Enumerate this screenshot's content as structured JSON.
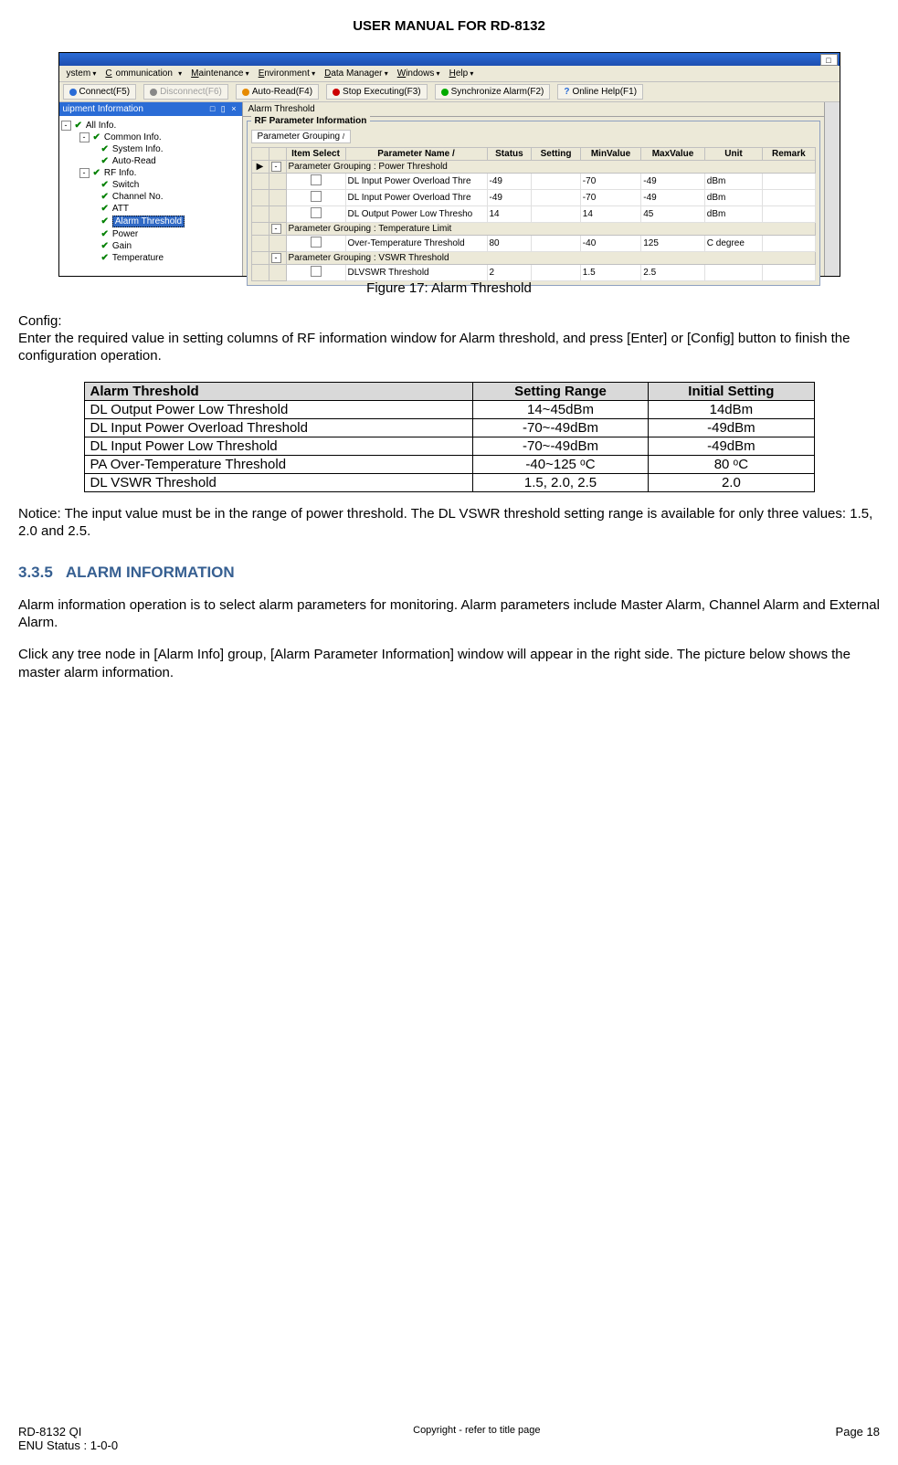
{
  "doc": {
    "title": "USER MANUAL FOR RD-8132"
  },
  "screenshot": {
    "menubar": [
      "ystem",
      "Communication",
      "Maintenance",
      "Environment",
      "Data Manager",
      "Windows",
      "Help"
    ],
    "toolbar": [
      {
        "label": "Connect(F5)",
        "disabled": false
      },
      {
        "label": "Disconnect(F6)",
        "disabled": true
      },
      {
        "label": "Auto-Read(F4)",
        "disabled": false
      },
      {
        "label": "Stop Executing(F3)",
        "disabled": false
      },
      {
        "label": "Synchronize Alarm(F2)",
        "disabled": false
      },
      {
        "label": "Online Help(F1)",
        "disabled": false
      }
    ],
    "tree": {
      "title": "uipment Information",
      "nodes": [
        {
          "lvl": 1,
          "exp": "-",
          "label": "All Info."
        },
        {
          "lvl": 2,
          "exp": "-",
          "label": "Common Info.",
          "parentexp": true
        },
        {
          "lvl": 2,
          "exp": "",
          "label": "System Info.",
          "leaf": true,
          "in": 3
        },
        {
          "lvl": 2,
          "exp": "",
          "label": "Auto-Read",
          "leaf": true,
          "in": 3
        },
        {
          "lvl": 2,
          "exp": "-",
          "label": "RF Info.",
          "parentexp": true
        },
        {
          "lvl": 2,
          "exp": "",
          "label": "Switch",
          "leaf": true,
          "in": 3
        },
        {
          "lvl": 2,
          "exp": "",
          "label": "Channel No.",
          "leaf": true,
          "in": 3
        },
        {
          "lvl": 2,
          "exp": "",
          "label": "ATT",
          "leaf": true,
          "in": 3
        },
        {
          "lvl": 2,
          "exp": "",
          "label": "Alarm Threshold",
          "leaf": true,
          "in": 3,
          "sel": true
        },
        {
          "lvl": 2,
          "exp": "",
          "label": "Power",
          "leaf": true,
          "in": 3
        },
        {
          "lvl": 2,
          "exp": "",
          "label": "Gain",
          "leaf": true,
          "in": 3
        },
        {
          "lvl": 2,
          "exp": "",
          "label": "Temperature",
          "leaf": true,
          "in": 3
        }
      ]
    },
    "main": {
      "tab": "Alarm Threshold",
      "group_title": "RF Parameter Information",
      "subtab": "Parameter Grouping",
      "grid": {
        "headers": [
          "",
          "",
          "Item Select",
          "Parameter Name   /",
          "Status",
          "Setting",
          "MinValue",
          "MaxValue",
          "Unit",
          "Remark"
        ],
        "groups": [
          {
            "title": "Parameter Grouping : Power Threshold",
            "rows": [
              {
                "name": "DL Input Power Overload Thre",
                "status": "-49",
                "setting": "",
                "min": "-70",
                "max": "-49",
                "unit": "dBm"
              },
              {
                "name": "DL Input Power Overload Thre",
                "status": "-49",
                "setting": "",
                "min": "-70",
                "max": "-49",
                "unit": "dBm"
              },
              {
                "name": "DL Output Power Low Thresho",
                "status": "14",
                "setting": "",
                "min": "14",
                "max": "45",
                "unit": "dBm"
              }
            ]
          },
          {
            "title": "Parameter Grouping : Temperature Limit",
            "rows": [
              {
                "name": "Over-Temperature Threshold",
                "status": "80",
                "setting": "",
                "min": "-40",
                "max": "125",
                "unit": "C degree"
              }
            ]
          },
          {
            "title": "Parameter Grouping : VSWR Threshold",
            "rows": [
              {
                "name": "DLVSWR Threshold",
                "status": "2",
                "setting": "",
                "min": "1.5",
                "max": "2.5",
                "unit": ""
              }
            ]
          }
        ]
      }
    }
  },
  "figure_caption": "Figure 17: Alarm Threshold",
  "body": {
    "config_label": "Config:",
    "config_text": "Enter the required value in setting columns of RF information window for Alarm threshold, and press [Enter] or [Config] button to finish the configuration operation.",
    "notice": "Notice: The input value must be in the range of power threshold. The DL VSWR threshold setting range is available for only three values: 1.5, 2.0 and 2.5.",
    "section_num": "3.3.5",
    "section_title": "ALARM INFORMATION",
    "p1": "Alarm information operation is to select alarm parameters for monitoring. Alarm parameters include Master Alarm, Channel Alarm and External Alarm.",
    "p2": "Click any tree node in [Alarm Info] group, [Alarm Parameter Information] window will appear in the right side. The picture below shows the master alarm information."
  },
  "alarm_table": {
    "headers": [
      "Alarm Threshold",
      "Setting Range",
      "Initial Setting"
    ],
    "rows": [
      [
        "DL Output Power Low Threshold",
        "14~45dBm",
        "14dBm"
      ],
      [
        "DL Input Power Overload Threshold",
        "-70~-49dBm",
        "-49dBm"
      ],
      [
        "DL Input Power Low Threshold",
        "-70~-49dBm",
        "-49dBm"
      ],
      [
        "PA Over-Temperature Threshold",
        "-40~125 ᵒC",
        "80 ᵒC"
      ],
      [
        "DL VSWR Threshold",
        "1.5, 2.0, 2.5",
        "2.0"
      ]
    ]
  },
  "footer": {
    "left1": "RD-8132 QI",
    "left2": "ENU Status : 1-0-0",
    "mid": "Copyright - refer to title page",
    "right": "Page 18"
  }
}
